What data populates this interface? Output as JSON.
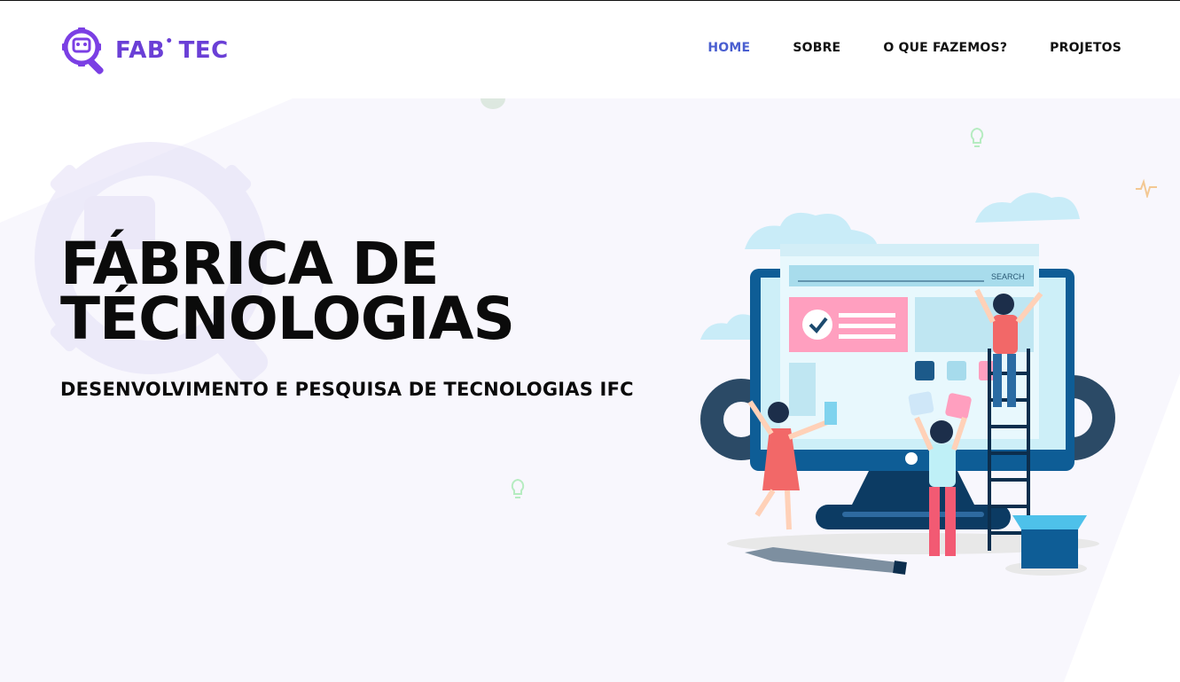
{
  "brand": {
    "name": "FAB",
    "suffix": "TEC",
    "dot": "•",
    "logo_icon": "robot-magnifier-icon"
  },
  "nav": {
    "items": [
      {
        "label": "HOME",
        "active": true
      },
      {
        "label": "SOBRE",
        "active": false
      },
      {
        "label": "O QUE FAZEMOS?",
        "active": false
      },
      {
        "label": "PROJETOS",
        "active": false
      }
    ]
  },
  "hero": {
    "title_line1": "FÁBRICA DE",
    "title_line2": "TÉCNOLOGIAS",
    "subtitle": "DESENVOLVIMENTO E PESQUISA DE TECNOLOGIAS IFC"
  },
  "illustration": {
    "search_label": "SEARCH",
    "icon": "web-development-team-illustration"
  },
  "colors": {
    "brand_purple": "#6a3fd6",
    "nav_active": "#4a5fd0",
    "text_dark": "#0b0b0b",
    "hero_bg": "#f8f7fd"
  }
}
